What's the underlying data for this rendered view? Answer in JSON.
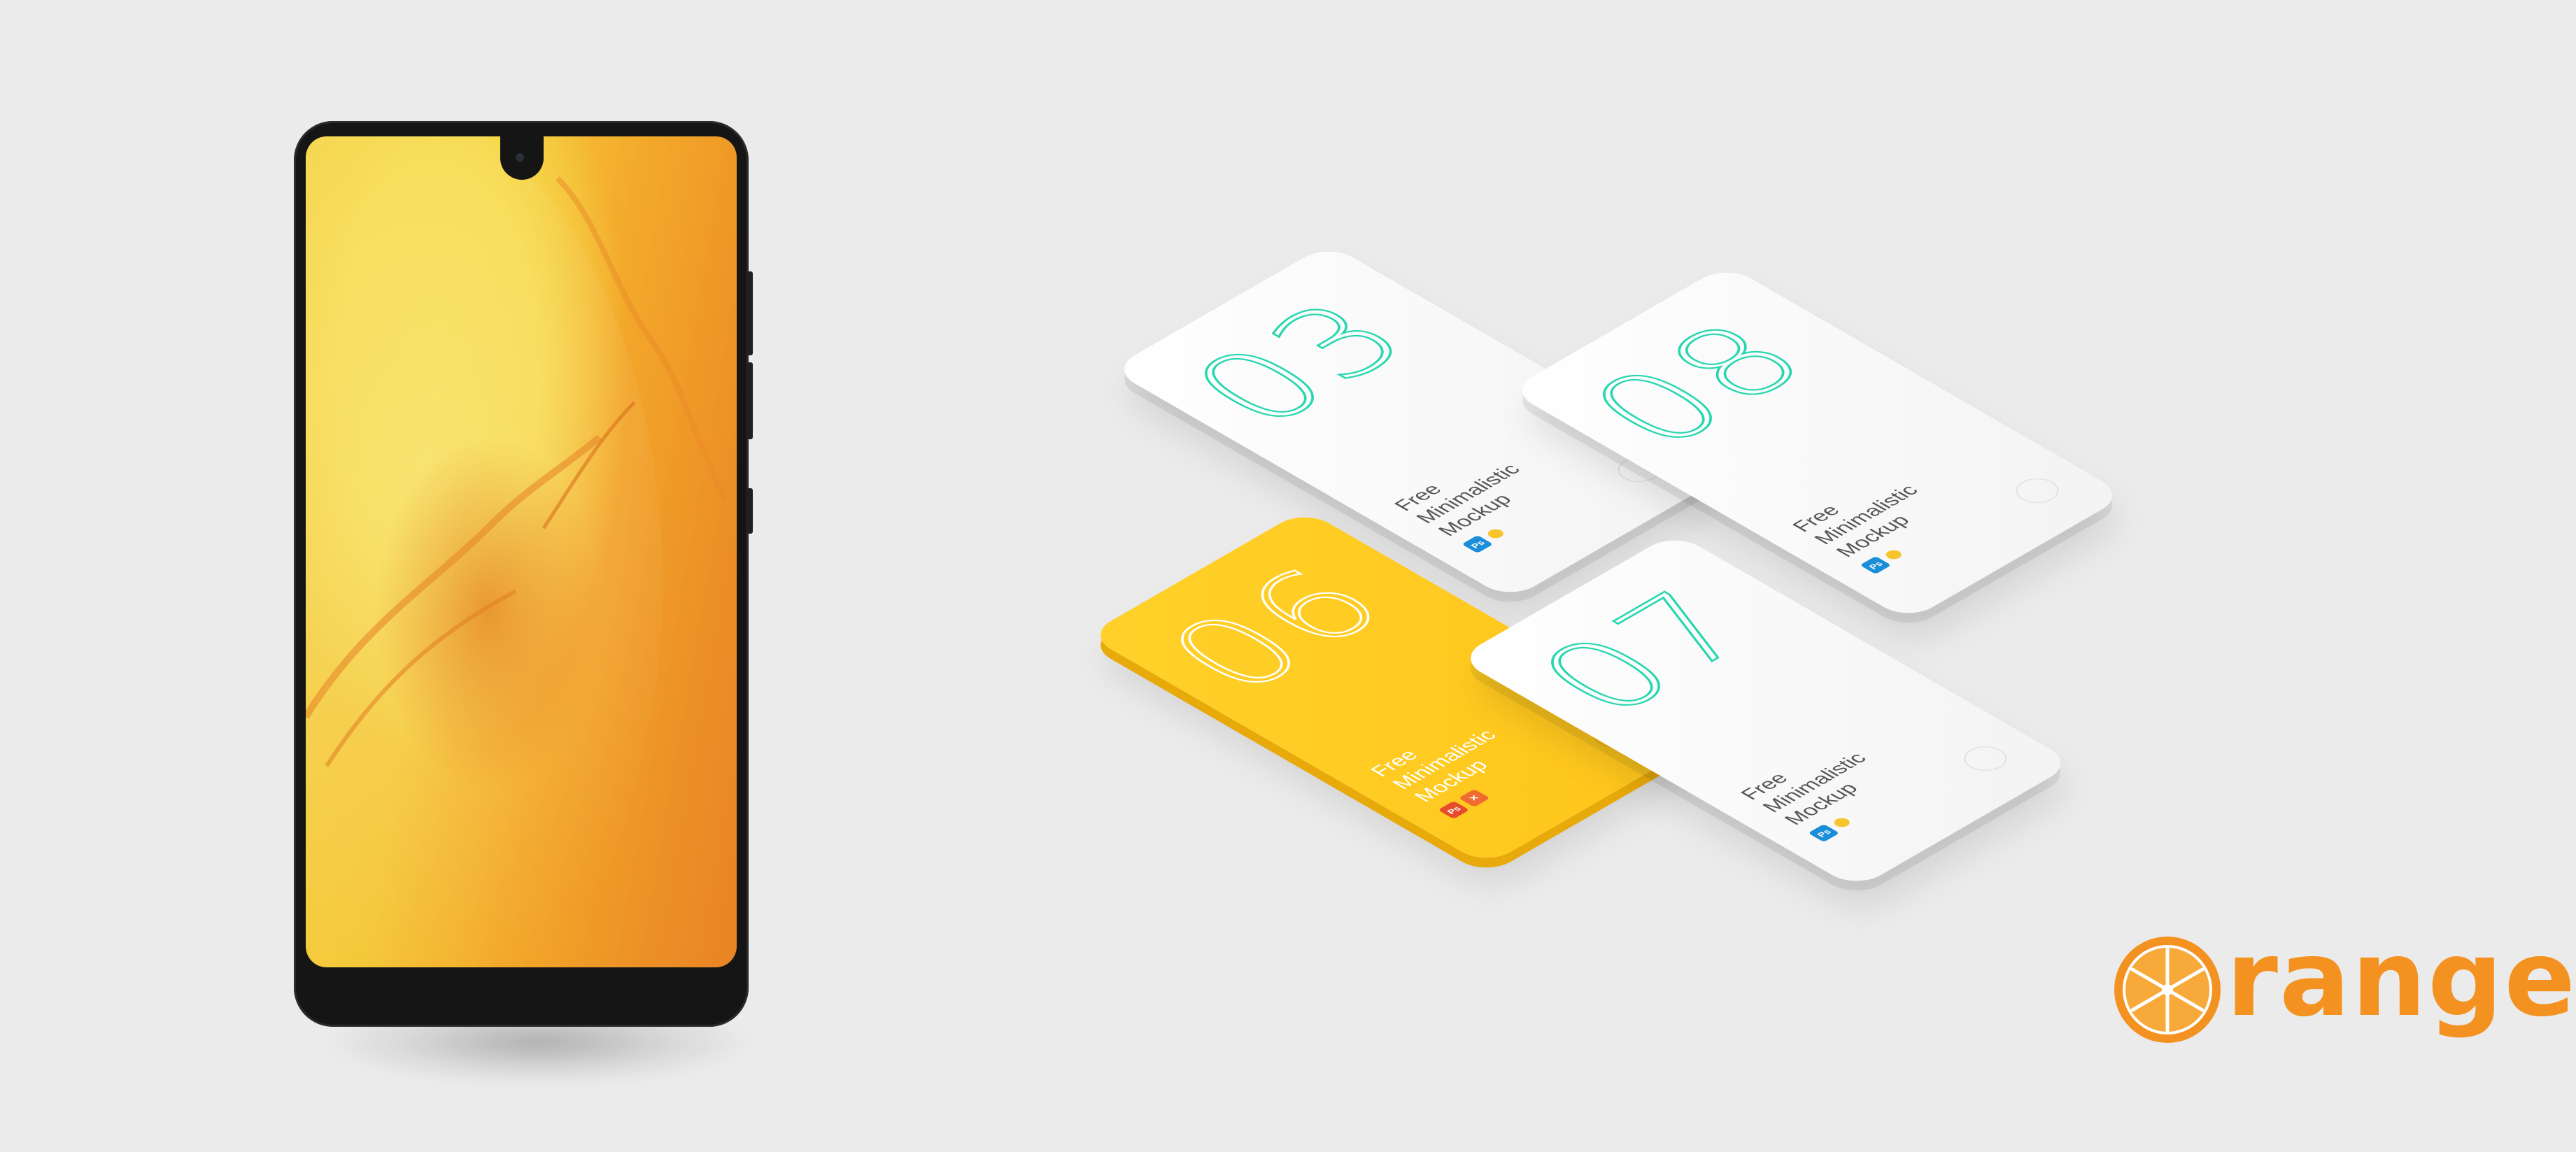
{
  "mockups": [
    {
      "number": "03",
      "lines": [
        "Free",
        "Minimalistic",
        "Mockup"
      ],
      "badges": [
        "Ps",
        ""
      ],
      "theme": "white"
    },
    {
      "number": "08",
      "lines": [
        "Free",
        "Minimalistic",
        "Mockup"
      ],
      "badges": [
        "Ps",
        ""
      ],
      "theme": "white"
    },
    {
      "number": "06",
      "lines": [
        "Free",
        "Minimalistic",
        "Mockup"
      ],
      "badges": [
        "Ps",
        "✕"
      ],
      "theme": "yellow"
    },
    {
      "number": "07",
      "lines": [
        "Free",
        "Minimalistic",
        "Mockup"
      ],
      "badges": [
        "Ps",
        ""
      ],
      "theme": "white"
    }
  ],
  "logo": {
    "word": "range",
    "icon": "orange-slice-icon"
  },
  "colors": {
    "background": "#ebebeb",
    "accent": "#f39220",
    "teal": "#27d7b0",
    "yellow": "#ffc51a"
  }
}
